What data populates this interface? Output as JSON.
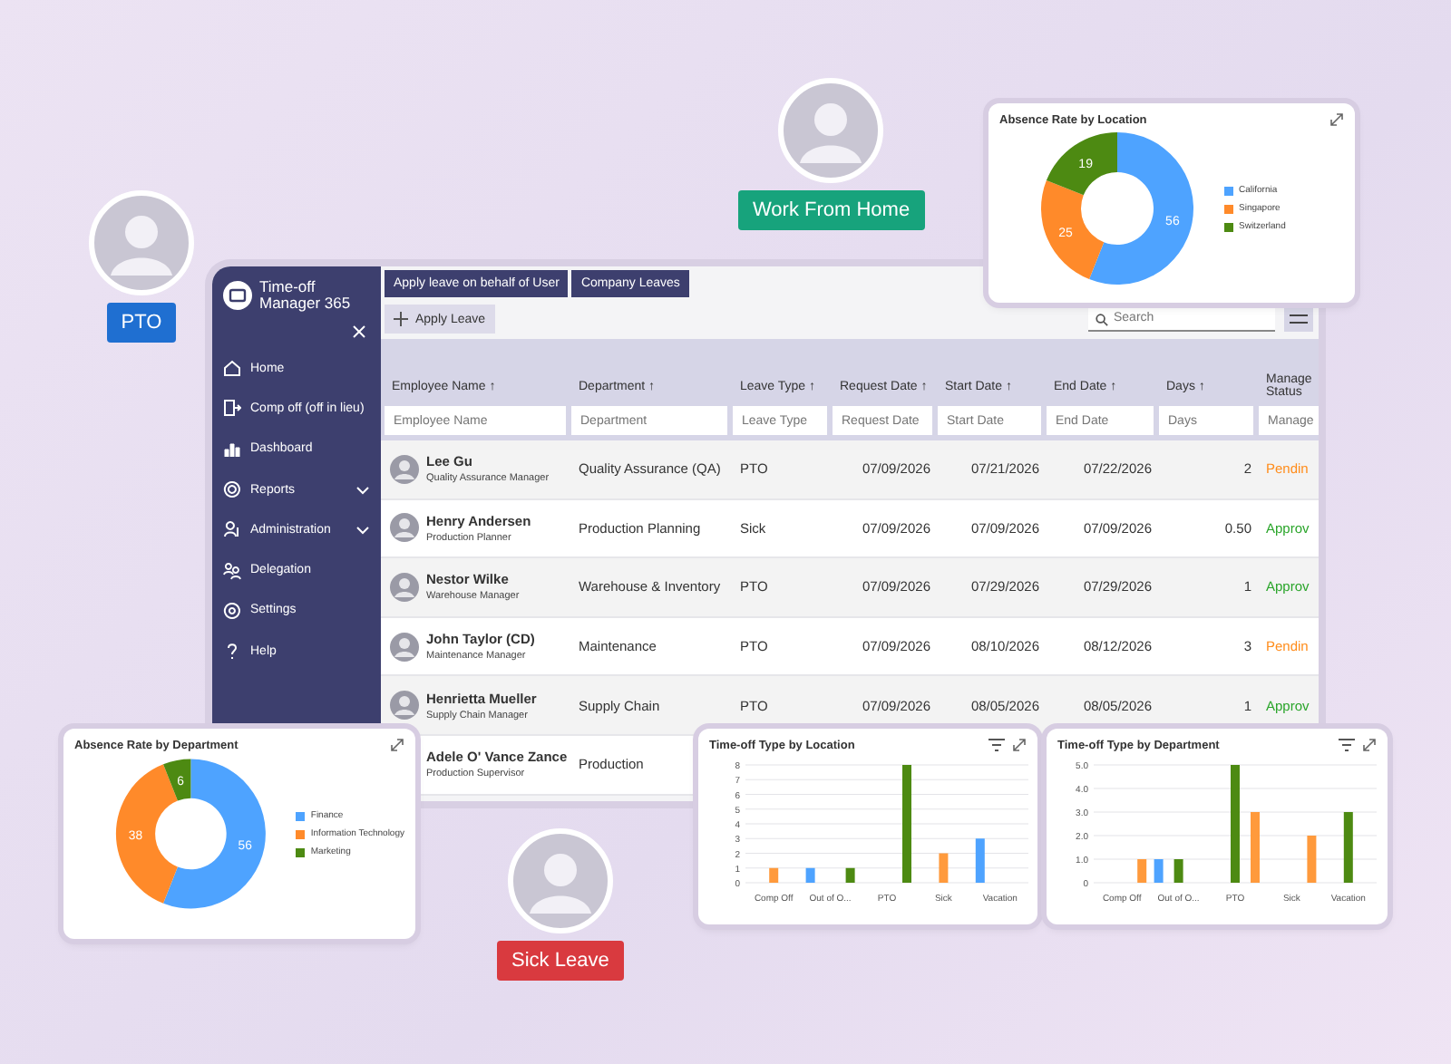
{
  "app": {
    "title": "Time-off Manager 365"
  },
  "sidebar": {
    "items": [
      {
        "label": "Home",
        "expandable": false
      },
      {
        "label": "Comp off (off in lieu)",
        "expandable": false
      },
      {
        "label": "Dashboard",
        "expandable": false
      },
      {
        "label": "Reports",
        "expandable": true
      },
      {
        "label": "Administration",
        "expandable": true
      },
      {
        "label": "Delegation",
        "expandable": false
      },
      {
        "label": "Settings",
        "expandable": false
      },
      {
        "label": "Help",
        "expandable": false
      }
    ]
  },
  "tabs": [
    "Apply leave on behalf of User",
    "Company Leaves"
  ],
  "apply_button": "Apply Leave",
  "search": {
    "placeholder": "Search"
  },
  "table": {
    "columns": [
      {
        "label": "Employee Name ↑",
        "placeholder": "Employee Name"
      },
      {
        "label": "Department ↑",
        "placeholder": "Department"
      },
      {
        "label": "Leave Type ↑",
        "placeholder": "Leave Type"
      },
      {
        "label": "Request Date ↑",
        "placeholder": "Request Date"
      },
      {
        "label": "Start Date ↑",
        "placeholder": "Start Date"
      },
      {
        "label": "End Date ↑",
        "placeholder": "End Date"
      },
      {
        "label": "Days ↑",
        "placeholder": "Days"
      },
      {
        "label": "Manage Status",
        "placeholder": "Manage"
      }
    ],
    "rows": [
      {
        "name": "Lee Gu",
        "title": "Quality Assurance Manager",
        "department": "Quality Assurance (QA)",
        "leave_type": "PTO",
        "request_date": "07/09/2026",
        "start_date": "07/21/2026",
        "end_date": "07/22/2026",
        "days": "2",
        "status": "Pendin",
        "color": "#ff8c1a"
      },
      {
        "name": "Henry Andersen",
        "title": "Production Planner",
        "department": "Production Planning",
        "leave_type": "Sick",
        "request_date": "07/09/2026",
        "start_date": "07/09/2026",
        "end_date": "07/09/2026",
        "days": "0.50",
        "status": "Approv",
        "color": "#2aa52a"
      },
      {
        "name": "Nestor Wilke",
        "title": "Warehouse Manager",
        "department": "Warehouse & Inventory",
        "leave_type": "PTO",
        "request_date": "07/09/2026",
        "start_date": "07/29/2026",
        "end_date": "07/29/2026",
        "days": "1",
        "status": "Approv",
        "color": "#2aa52a"
      },
      {
        "name": "John Taylor (CD)",
        "title": "Maintenance Manager",
        "department": "Maintenance",
        "leave_type": "PTO",
        "request_date": "07/09/2026",
        "start_date": "08/10/2026",
        "end_date": "08/12/2026",
        "days": "3",
        "status": "Pendin",
        "color": "#ff8c1a"
      },
      {
        "name": "Henrietta Mueller",
        "title": "Supply Chain Manager",
        "department": "Supply Chain",
        "leave_type": "PTO",
        "request_date": "07/09/2026",
        "start_date": "08/05/2026",
        "end_date": "08/05/2026",
        "days": "1",
        "status": "Approv",
        "color": "#2aa52a"
      },
      {
        "name": "Adele O' Vance Zance",
        "title": "Production Supervisor",
        "department": "Production"
      }
    ]
  },
  "people": [
    {
      "label": "PTO",
      "color": "#1f6fd1"
    },
    {
      "label": "Work From Home",
      "color": "#17a37c"
    },
    {
      "label": "Sick Leave",
      "color": "#d93a3f"
    }
  ],
  "donuts": [
    {
      "chart_data": {
        "type": "donut",
        "title": "Absence Rate by Location",
        "categories": [
          "California",
          "Singapore",
          "Switzerland"
        ],
        "series": [
          {
            "colors": [
              "#4ea3ff",
              "#ff8a2a",
              "#4d8a12"
            ],
            "values": [
              56,
              25,
              19
            ]
          }
        ],
        "data_labels": true,
        "legend": true
      }
    },
    {
      "chart_data": {
        "type": "donut",
        "title": "Absence Rate by Department",
        "categories": [
          "Finance",
          "Information Technology",
          "Marketing"
        ],
        "series": [
          {
            "colors": [
              "#4ea3ff",
              "#ff8a2a",
              "#4d8a12"
            ],
            "values": [
              56,
              38,
              6
            ]
          }
        ],
        "data_labels": true,
        "legend": true
      }
    }
  ],
  "bar_charts": [
    {
      "chart_data": {
        "type": "bar",
        "title": "Time-off Type by Location",
        "categories": [
          "Comp Off",
          "Out of O...",
          "PTO",
          "Sick",
          "Vacation"
        ],
        "series": [
          {
            "color": "#4ea3ff",
            "values": [
              null,
              1,
              null,
              null,
              3
            ]
          },
          {
            "color": "#ff9a3c",
            "values": [
              1,
              null,
              null,
              2,
              null
            ]
          },
          {
            "color": "#4d8a12",
            "values": [
              null,
              1,
              8,
              null,
              null
            ]
          }
        ],
        "ylim": [
          0,
          8
        ],
        "yticks": [
          0,
          1,
          2,
          3,
          4,
          5,
          6,
          7,
          8
        ],
        "grid": true
      }
    },
    {
      "chart_data": {
        "type": "bar",
        "title": "Time-off Type by Department",
        "categories": [
          "Comp Off",
          "Out of O...",
          "PTO",
          "Sick",
          "Vacation"
        ],
        "series": [
          {
            "color": "#4ea3ff",
            "values": [
              null,
              1,
              null,
              null,
              null
            ]
          },
          {
            "color": "#4d8a12",
            "values": [
              null,
              1,
              5,
              null,
              3
            ]
          },
          {
            "color": "#ff9a3c",
            "values": [
              1,
              null,
              3,
              2,
              null
            ]
          }
        ],
        "ylim": [
          0,
          5
        ],
        "yticks": [
          {
            "value": 0,
            "label": "0"
          },
          {
            "value": 1,
            "label": "1.0"
          },
          {
            "value": 2,
            "label": "2.0"
          },
          {
            "value": 3,
            "label": "3.0"
          },
          {
            "value": 4,
            "label": "4.0"
          },
          {
            "value": 5,
            "label": "5.0"
          }
        ],
        "grid": true
      }
    }
  ]
}
